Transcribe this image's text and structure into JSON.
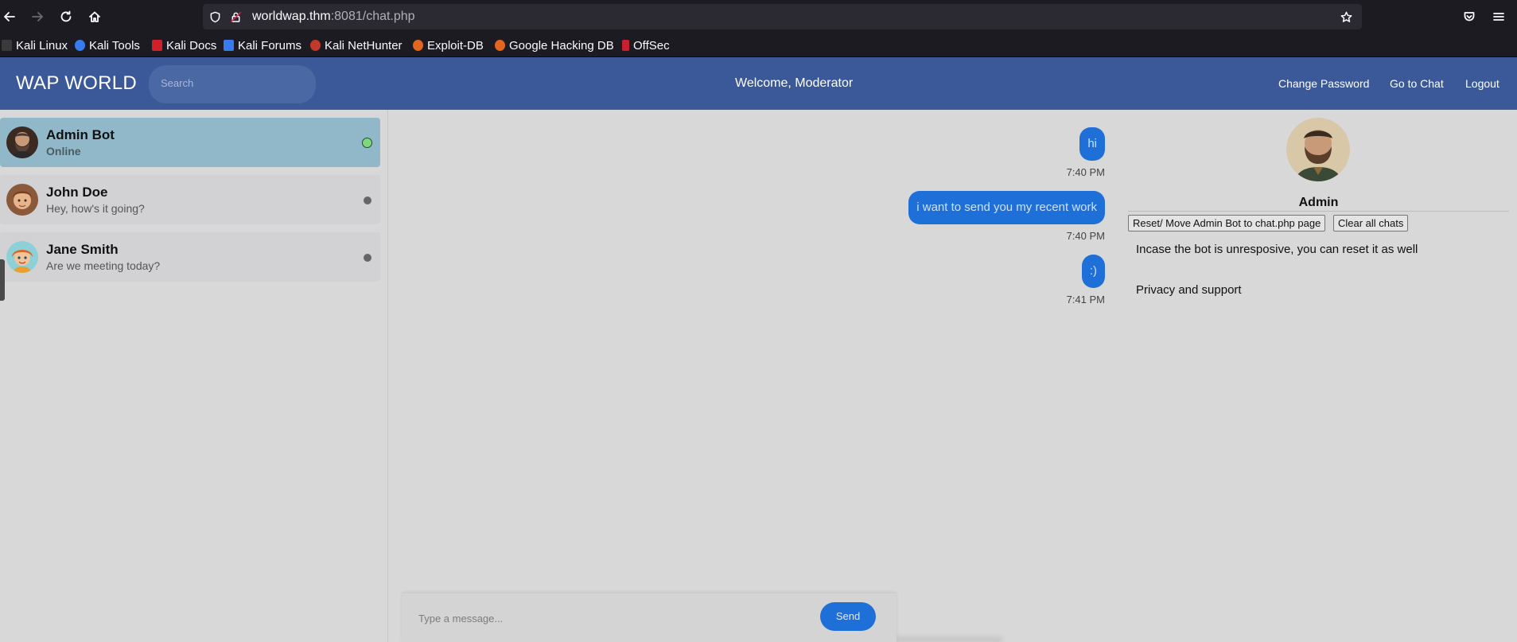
{
  "browser": {
    "url_host": "worldwap.thm",
    "url_rest": ":8081/chat.php",
    "bookmarks": [
      "Kali Linux",
      "Kali Tools",
      "Kali Docs",
      "Kali Forums",
      "Kali NetHunter",
      "Exploit-DB",
      "Google Hacking DB",
      "OffSec"
    ]
  },
  "header": {
    "logo": "WAP WORLD",
    "search_placeholder": "Search",
    "welcome": "Welcome, Moderator",
    "links": [
      "Change Password",
      "Go to Chat",
      "Logout"
    ]
  },
  "contacts": [
    {
      "name": "Admin Bot",
      "subtitle": "Online",
      "status": "online",
      "active": true
    },
    {
      "name": "John Doe",
      "subtitle": "Hey, how's it going?",
      "status": "offline",
      "active": false
    },
    {
      "name": "Jane Smith",
      "subtitle": "Are we meeting today?",
      "status": "offline",
      "active": false
    }
  ],
  "messages": [
    {
      "text": "hi",
      "time": "7:40 PM"
    },
    {
      "text": "i want to send you my recent work",
      "time": "7:40 PM"
    },
    {
      "text": ":)",
      "time": "7:41 PM"
    }
  ],
  "composer": {
    "placeholder": "Type a message...",
    "send_label": "Send"
  },
  "profile": {
    "name": "Admin",
    "reset_button": "Reset/ Move Admin Bot to chat.php page",
    "clear_button": "Clear all chats",
    "note": "Incase the bot is unresposive, you can reset it as well",
    "support": "Privacy and support"
  },
  "colors": {
    "header": "#3b5998",
    "bubble": "#1f6fd8",
    "active_contact": "#90b8c8",
    "online_dot": "#7ed87e"
  }
}
